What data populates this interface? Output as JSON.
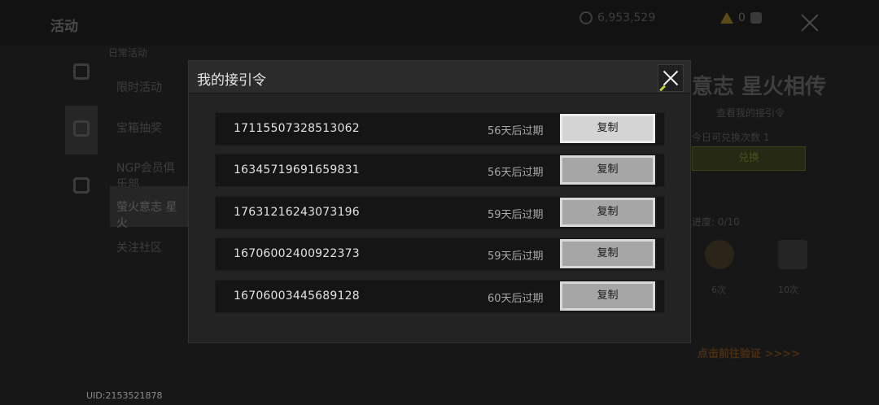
{
  "background": {
    "page_title": "活动",
    "currency_value": "6,953,529",
    "warning_count": "0",
    "section_label": "日常活动",
    "menu_items": [
      "限时活动",
      "宝箱抽奖",
      "NGP会员俱乐部",
      "萤火意志 星火",
      "关注社区"
    ],
    "banner_title": "意志 星火相传",
    "view_codes_link": "查看我的接引令",
    "redeem_count_text": "今日可兑换次数 1",
    "redeem_button": "兑换",
    "progress_text": "进度: 0/10",
    "reward_labels": [
      "6次",
      "10次"
    ],
    "verify_text": "点击前往验证 >>>>",
    "uid": "UID:2153521878"
  },
  "modal": {
    "title": "我的接引令",
    "codes": [
      {
        "code": "17115507328513062",
        "expiry": "56天后过期",
        "copy_label": "复制"
      },
      {
        "code": "16345719691659831",
        "expiry": "56天后过期",
        "copy_label": "复制"
      },
      {
        "code": "17631216243073196",
        "expiry": "59天后过期",
        "copy_label": "复制"
      },
      {
        "code": "16706002400922373",
        "expiry": "59天后过期",
        "copy_label": "复制"
      },
      {
        "code": "16706003445689128",
        "expiry": "60天后过期",
        "copy_label": "复制"
      }
    ]
  },
  "colors": {
    "modal_bg": "#232323",
    "row_bg": "#151515",
    "button_bg": "#a6a6a6",
    "close_accent": "#b8d230"
  }
}
